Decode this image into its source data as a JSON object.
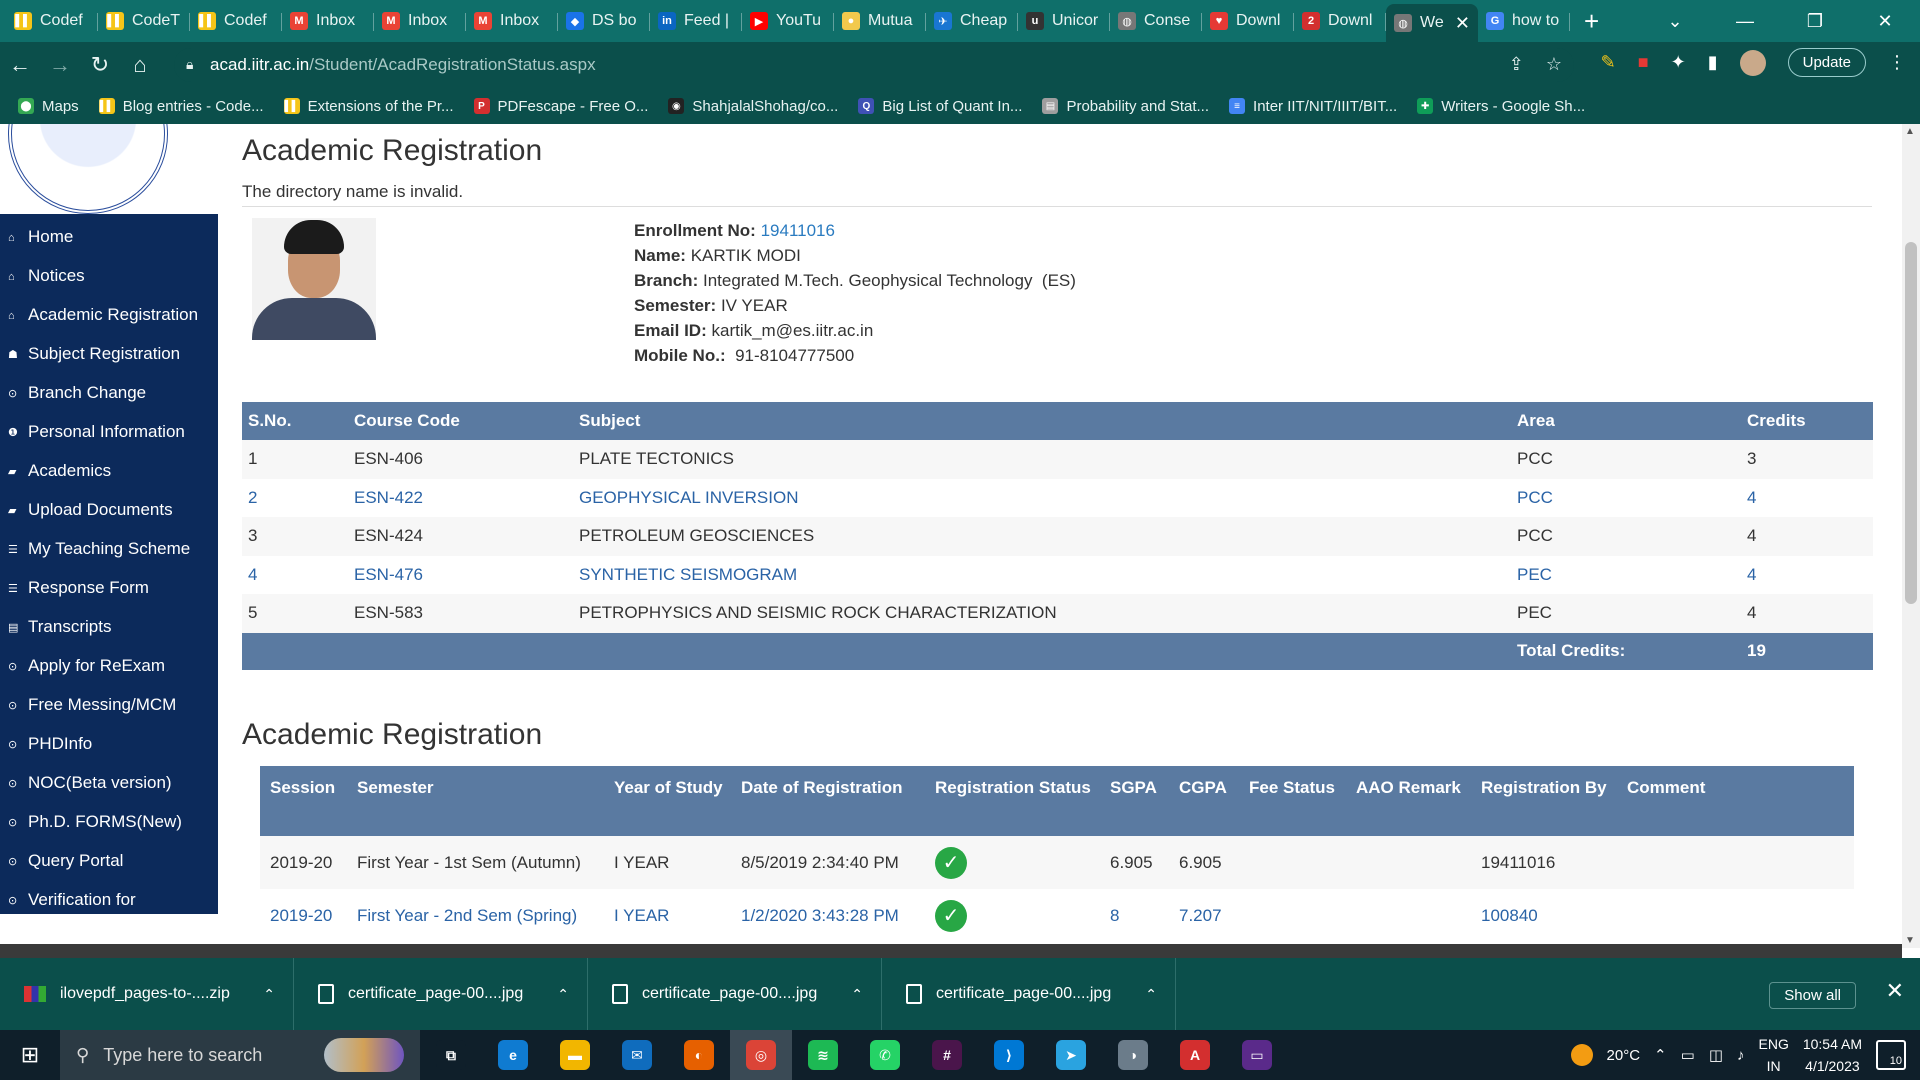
{
  "browser": {
    "tabs": [
      {
        "label": "Codef",
        "icon": "codeforces-icon",
        "color": "#f5c518",
        "glyph": "▌▌"
      },
      {
        "label": "CodeT",
        "icon": "codeforces-icon",
        "color": "#f5c518",
        "glyph": "▌▌"
      },
      {
        "label": "Codef",
        "icon": "codeforces-icon",
        "color": "#f5c518",
        "glyph": "▌▌"
      },
      {
        "label": "Inbox",
        "icon": "gmail-icon",
        "color": "#ea4335",
        "glyph": "M"
      },
      {
        "label": "Inbox",
        "icon": "gmail-icon",
        "color": "#ea4335",
        "glyph": "M"
      },
      {
        "label": "Inbox",
        "icon": "gmail-icon",
        "color": "#ea4335",
        "glyph": "M"
      },
      {
        "label": "DS bo",
        "icon": "ds-icon",
        "color": "#1a73e8",
        "glyph": "◆"
      },
      {
        "label": "Feed |",
        "icon": "linkedin-icon",
        "color": "#0a66c2",
        "glyph": "in"
      },
      {
        "label": "YouTu",
        "icon": "youtube-icon",
        "color": "#ff0000",
        "glyph": "▶"
      },
      {
        "label": "Mutua",
        "icon": "mutual-fund-icon",
        "color": "#f2c94c",
        "glyph": "●"
      },
      {
        "label": "Cheap",
        "icon": "flight-icon",
        "color": "#1976d2",
        "glyph": "✈"
      },
      {
        "label": "Unicor",
        "icon": "unicorn-icon",
        "color": "#333333",
        "glyph": "u"
      },
      {
        "label": "Conse",
        "icon": "globe-icon",
        "color": "#777777",
        "glyph": "◍"
      },
      {
        "label": "Downl",
        "icon": "heart-icon",
        "color": "#e53935",
        "glyph": "♥"
      },
      {
        "label": "Downl",
        "icon": "download-number-icon",
        "color": "#d32f2f",
        "glyph": "2"
      },
      {
        "label": "We",
        "icon": "globe-icon",
        "color": "#777777",
        "glyph": "◍",
        "active": true
      },
      {
        "label": "how to",
        "icon": "google-icon",
        "color": "#4285f4",
        "glyph": "G"
      }
    ],
    "new_tab": "+",
    "window_controls": {
      "tabs_menu": "⌄",
      "minimize": "—",
      "maximize": "❐",
      "close": "✕"
    },
    "url_host": "acad.iitr.ac.in",
    "url_path": "/Student/AcadRegistrationStatus.aspx",
    "update_label": "Update",
    "bookmarks": [
      {
        "label": "Maps",
        "icon": "maps-icon",
        "color": "#34a853",
        "glyph": "⬤"
      },
      {
        "label": "Blog entries - Code...",
        "icon": "codeforces-icon",
        "color": "#f5c518",
        "glyph": "▌▌"
      },
      {
        "label": "Extensions of the Pr...",
        "icon": "codeforces-icon",
        "color": "#f5c518",
        "glyph": "▌▌"
      },
      {
        "label": "PDFescape - Free O...",
        "icon": "pdf-icon",
        "color": "#d32f2f",
        "glyph": "P"
      },
      {
        "label": "ShahjalalShohag/co...",
        "icon": "github-icon",
        "color": "#222222",
        "glyph": "◉"
      },
      {
        "label": "Big List of Quant In...",
        "icon": "quant-icon",
        "color": "#3f51b5",
        "glyph": "Q"
      },
      {
        "label": "Probability and Stat...",
        "icon": "document-icon",
        "color": "#9e9e9e",
        "glyph": "▤"
      },
      {
        "label": "Inter IIT/NIT/IIIT/BIT...",
        "icon": "google-docs-icon",
        "color": "#4285f4",
        "glyph": "≡"
      },
      {
        "label": "Writers - Google Sh...",
        "icon": "google-sheets-icon",
        "color": "#0f9d58",
        "glyph": "✚"
      }
    ]
  },
  "sidebar": {
    "items": [
      {
        "label": "Home",
        "icon": "house-icon",
        "glyph": "⌂"
      },
      {
        "label": "Notices",
        "icon": "house-icon",
        "glyph": "⌂"
      },
      {
        "label": "Academic Registration",
        "icon": "house-icon",
        "glyph": "⌂"
      },
      {
        "label": "Subject Registration",
        "icon": "group-icon",
        "glyph": "☗"
      },
      {
        "label": "Branch Change",
        "icon": "circle-arrow-icon",
        "glyph": "⊙"
      },
      {
        "label": "Personal Information",
        "icon": "info-icon",
        "glyph": "❶"
      },
      {
        "label": "Academics",
        "icon": "book-icon",
        "glyph": "▰"
      },
      {
        "label": "Upload Documents",
        "icon": "book-icon",
        "glyph": "▰"
      },
      {
        "label": "My Teaching Scheme",
        "icon": "graduation-cap-icon",
        "glyph": "☰"
      },
      {
        "label": "Response Form",
        "icon": "graduation-cap-icon",
        "glyph": "☰"
      },
      {
        "label": "Transcripts",
        "icon": "list-icon",
        "glyph": "▤"
      },
      {
        "label": "Apply for ReExam",
        "icon": "circle-arrow-icon",
        "glyph": "⊙"
      },
      {
        "label": "Free Messing/MCM",
        "icon": "circle-arrow-icon",
        "glyph": "⊙"
      },
      {
        "label": "PHDInfo",
        "icon": "circle-arrow-icon",
        "glyph": "⊙"
      },
      {
        "label": "NOC(Beta version)",
        "icon": "circle-arrow-icon",
        "glyph": "⊙"
      },
      {
        "label": "Ph.D. FORMS(New)",
        "icon": "circle-arrow-icon",
        "glyph": "⊙"
      },
      {
        "label": "Query Portal",
        "icon": "circle-arrow-icon",
        "glyph": "⊙"
      },
      {
        "label": "Verification for Convocation",
        "icon": "circle-arrow-icon",
        "glyph": "⊙"
      }
    ]
  },
  "main": {
    "title": "Academic Registration",
    "error_message": "The directory name is invalid.",
    "student": {
      "enrollment_label": "Enrollment No:",
      "enrollment_value": "19411016",
      "name_label": "Name:",
      "name_value": "KARTIK MODI",
      "branch_label": "Branch:",
      "branch_value": "Integrated M.Tech. Geophysical Technology  (ES)",
      "semester_label": "Semester:",
      "semester_value": "IV YEAR",
      "email_label": "Email ID:",
      "email_value": "kartik_m@es.iitr.ac.in",
      "mobile_label": "Mobile No.:",
      "mobile_value": " 91-8104777500"
    },
    "courses": {
      "headers": [
        "S.No.",
        "Course Code",
        "Subject",
        "Area",
        "Credits"
      ],
      "rows": [
        [
          "1",
          "ESN-406",
          "PLATE TECTONICS",
          "PCC",
          "3"
        ],
        [
          "2",
          "ESN-422",
          "GEOPHYSICAL INVERSION",
          "PCC",
          "4"
        ],
        [
          "3",
          "ESN-424",
          "PETROLEUM GEOSCIENCES",
          "PCC",
          "4"
        ],
        [
          "4",
          "ESN-476",
          "SYNTHETIC SEISMOGRAM",
          "PEC",
          "4"
        ],
        [
          "5",
          "ESN-583",
          "PETROPHYSICS AND SEISMIC ROCK CHARACTERIZATION",
          "PEC",
          "4"
        ]
      ],
      "total_label": "Total Credits:",
      "total_value": "19"
    },
    "history_title": "Academic Registration",
    "history": {
      "headers": [
        "Session",
        "Semester",
        "Year of Study",
        "Date of Registration",
        "Registration Status",
        "SGPA",
        "CGPA",
        "Fee Status",
        "AAO Remark",
        "Registration By",
        "Comment"
      ],
      "rows": [
        {
          "session": "2019-20",
          "semester": "First Year - 1st Sem (Autumn)",
          "year": "I YEAR",
          "date": "8/5/2019 2:34:40 PM",
          "status": "approved",
          "sgpa": "6.905",
          "cgpa": "6.905",
          "fee": "",
          "aao": "",
          "by": "19411016",
          "comment": ""
        },
        {
          "session": "2019-20",
          "semester": "First Year - 2nd Sem (Spring)",
          "year": "I YEAR",
          "date": "1/2/2020 3:43:28 PM",
          "status": "approved",
          "sgpa": "8",
          "cgpa": "7.207",
          "fee": "",
          "aao": "",
          "by": "100840",
          "comment": ""
        }
      ]
    }
  },
  "downloads": {
    "items": [
      {
        "label": "ilovepdf_pages-to-....zip",
        "icon": "zip-icon"
      },
      {
        "label": "certificate_page-00....jpg",
        "icon": "file-icon"
      },
      {
        "label": "certificate_page-00....jpg",
        "icon": "file-icon"
      },
      {
        "label": "certificate_page-00....jpg",
        "icon": "file-icon"
      }
    ],
    "show_all": "Show all"
  },
  "taskbar": {
    "search_placeholder": "Type here to search",
    "apps": [
      {
        "name": "task-view-icon",
        "color": "#0f1f2a",
        "glyph": "⧉"
      },
      {
        "name": "edge-icon",
        "color": "#0f7bd1",
        "glyph": "e"
      },
      {
        "name": "file-explorer-icon",
        "color": "#f2b600",
        "glyph": "▬"
      },
      {
        "name": "mail-icon",
        "color": "#0f6cbd",
        "glyph": "✉"
      },
      {
        "name": "firefox-icon",
        "color": "#e66000",
        "glyph": "◐"
      },
      {
        "name": "chrome-icon",
        "color": "#db4437",
        "glyph": "◎",
        "active": true
      },
      {
        "name": "spotify-icon",
        "color": "#1db954",
        "glyph": "≋"
      },
      {
        "name": "whatsapp-icon",
        "color": "#25d366",
        "glyph": "✆"
      },
      {
        "name": "slack-icon",
        "color": "#4a154b",
        "glyph": "#"
      },
      {
        "name": "vscode-icon",
        "color": "#0078d4",
        "glyph": "⟩"
      },
      {
        "name": "telegram-icon",
        "color": "#2aa3e0",
        "glyph": "➤"
      },
      {
        "name": "cortana-icon",
        "color": "#6b7c8a",
        "glyph": "◑"
      },
      {
        "name": "acrobat-icon",
        "color": "#d32f2f",
        "glyph": "A"
      },
      {
        "name": "terminal-icon",
        "color": "#5a2a8a",
        "glyph": "▭"
      }
    ],
    "weather": "20°C",
    "lang_top": "ENG",
    "lang_bottom": "IN",
    "time": "10:54 AM",
    "date": "4/1/2023",
    "notifications": "10"
  }
}
